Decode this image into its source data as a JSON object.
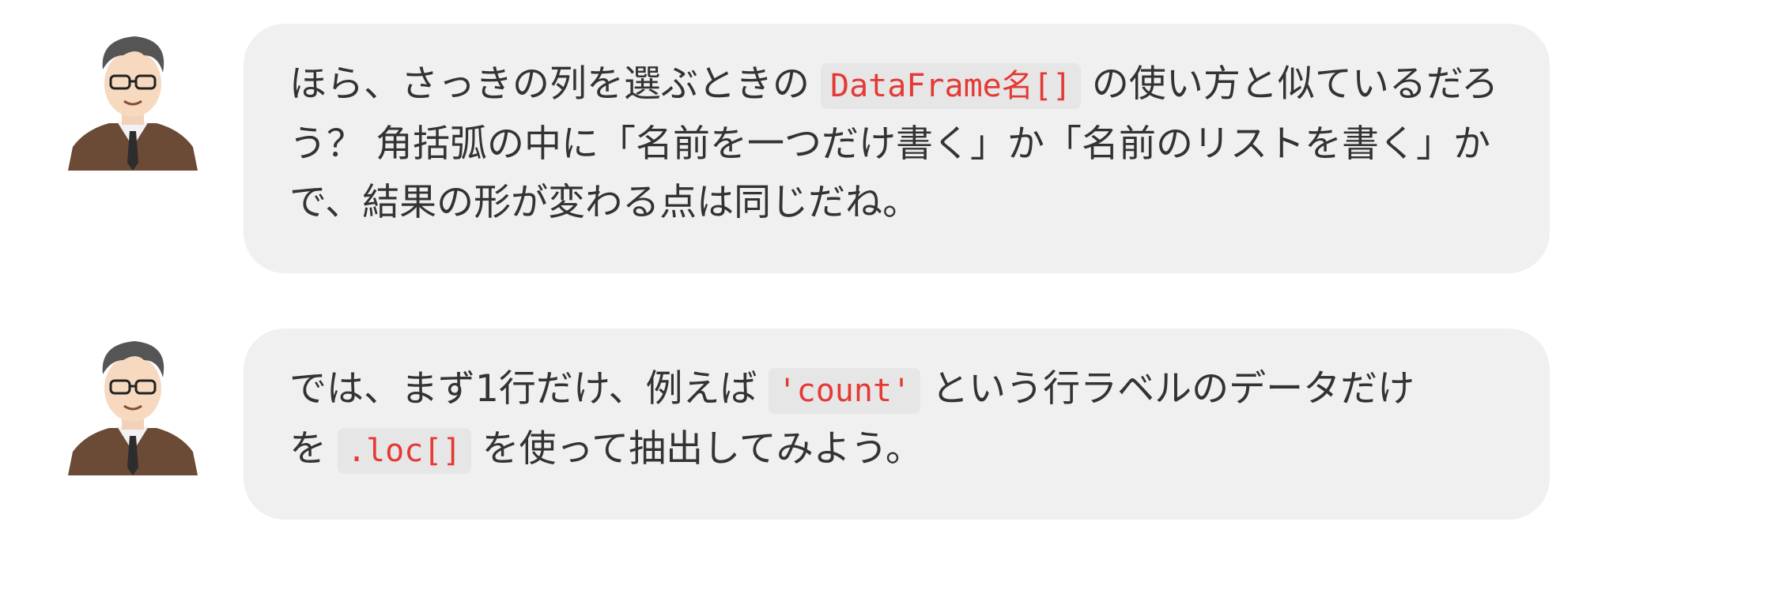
{
  "messages": [
    {
      "avatar_icon": "teacher-avatar-icon",
      "segments": [
        {
          "type": "text",
          "value": "ほら、さっきの列を選ぶときの"
        },
        {
          "type": "code",
          "value": "DataFrame名[]"
        },
        {
          "type": "text",
          "value": "の使い方と似ているだろう？ 角括弧の中に「名前を一つだけ書く」か「名前のリストを書く」かで、結果の形が変わる点は同じだね。"
        }
      ]
    },
    {
      "avatar_icon": "teacher-avatar-icon",
      "segments": [
        {
          "type": "text",
          "value": "では、まず1行だけ、例えば"
        },
        {
          "type": "code",
          "value": "'count'"
        },
        {
          "type": "text",
          "value": "という行ラベルのデータだけを"
        },
        {
          "type": "code",
          "value": ".loc[]"
        },
        {
          "type": "text",
          "value": "を使って抽出してみよう。"
        }
      ]
    }
  ],
  "colors": {
    "bubble_background": "#f0f0f0",
    "code_text": "#e53935",
    "code_background": "#e6e6e6",
    "body_text": "#333333"
  }
}
